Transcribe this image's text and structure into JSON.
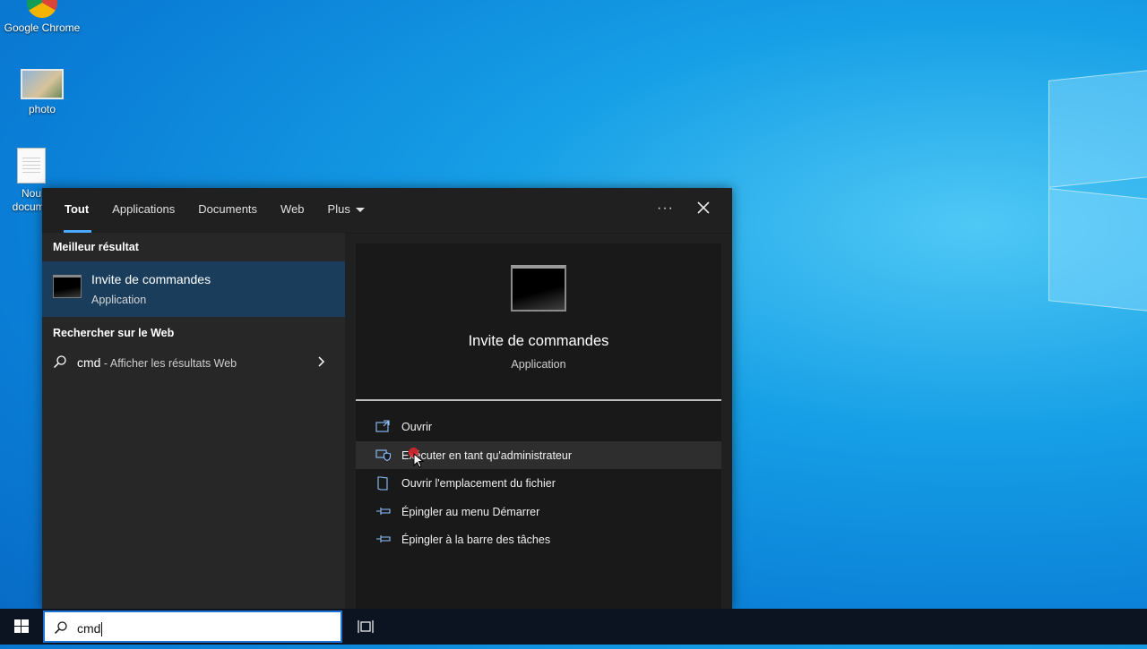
{
  "desktop": {
    "icons": [
      {
        "label": "Google Chrome"
      },
      {
        "label": "photo"
      },
      {
        "label": "Nou docume"
      }
    ]
  },
  "search": {
    "tabs": [
      {
        "label": "Tout",
        "active": true
      },
      {
        "label": "Applications"
      },
      {
        "label": "Documents"
      },
      {
        "label": "Web"
      },
      {
        "label": "Plus"
      }
    ],
    "more_label": "···",
    "best_match_title": "Meilleur résultat",
    "best_match": {
      "name": "Invite de commandes",
      "type": "Application"
    },
    "web_section_title": "Rechercher sur le Web",
    "web_result": {
      "query": "cmd",
      "suffix": " - Afficher les résultats Web"
    },
    "preview": {
      "name": "Invite de commandes",
      "type": "Application"
    },
    "actions": [
      {
        "label": "Ouvrir",
        "icon": "open-icon"
      },
      {
        "label": "Exécuter en tant qu'administrateur",
        "icon": "shield-admin-icon"
      },
      {
        "label": "Ouvrir l'emplacement du fichier",
        "icon": "file-location-icon"
      },
      {
        "label": "Épingler au menu Démarrer",
        "icon": "pin-icon"
      },
      {
        "label": "Épingler à la barre des tâches",
        "icon": "pin-icon"
      }
    ]
  },
  "taskbar": {
    "search_value": "cmd"
  },
  "colors": {
    "accent": "#4aa8ff",
    "selected_bg": "#1a3d5c",
    "panel_bg": "#202020"
  }
}
